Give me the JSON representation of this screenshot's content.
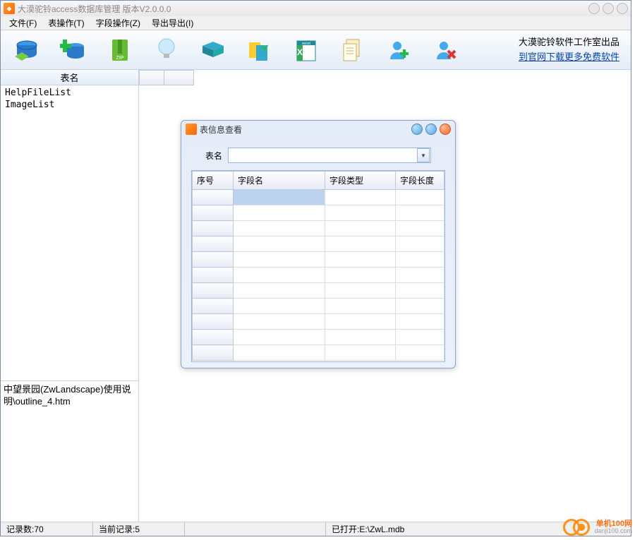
{
  "window": {
    "title": "大漠驼铃access数据库管理 版本V2.0.0.0"
  },
  "menu": {
    "file": "文件(F)",
    "table_ops": "表操作(T)",
    "field_ops": "字段操作(Z)",
    "import_export": "导出导出(I)"
  },
  "toolbar_right": {
    "line1": "大漠驼铃软件工作室出品",
    "link": "到官网下载更多免费软件"
  },
  "sidebar": {
    "header": "表名",
    "items": [
      "HelpFileList",
      "ImageList"
    ],
    "bottom_text": "中望景园(ZwLandscape)使用说明\\outline_4.htm"
  },
  "dialog": {
    "title": "表信息查看",
    "form_label": "表名",
    "combo_value": "",
    "columns": [
      "序号",
      "字段名",
      "字段类型",
      "字段长度"
    ]
  },
  "statusbar": {
    "records": "记录数:70",
    "current": "当前记录:5",
    "opened": "已打开:E:\\ZwL.mdb"
  },
  "watermark": {
    "name": "单机100网",
    "url": "danji100.com"
  }
}
